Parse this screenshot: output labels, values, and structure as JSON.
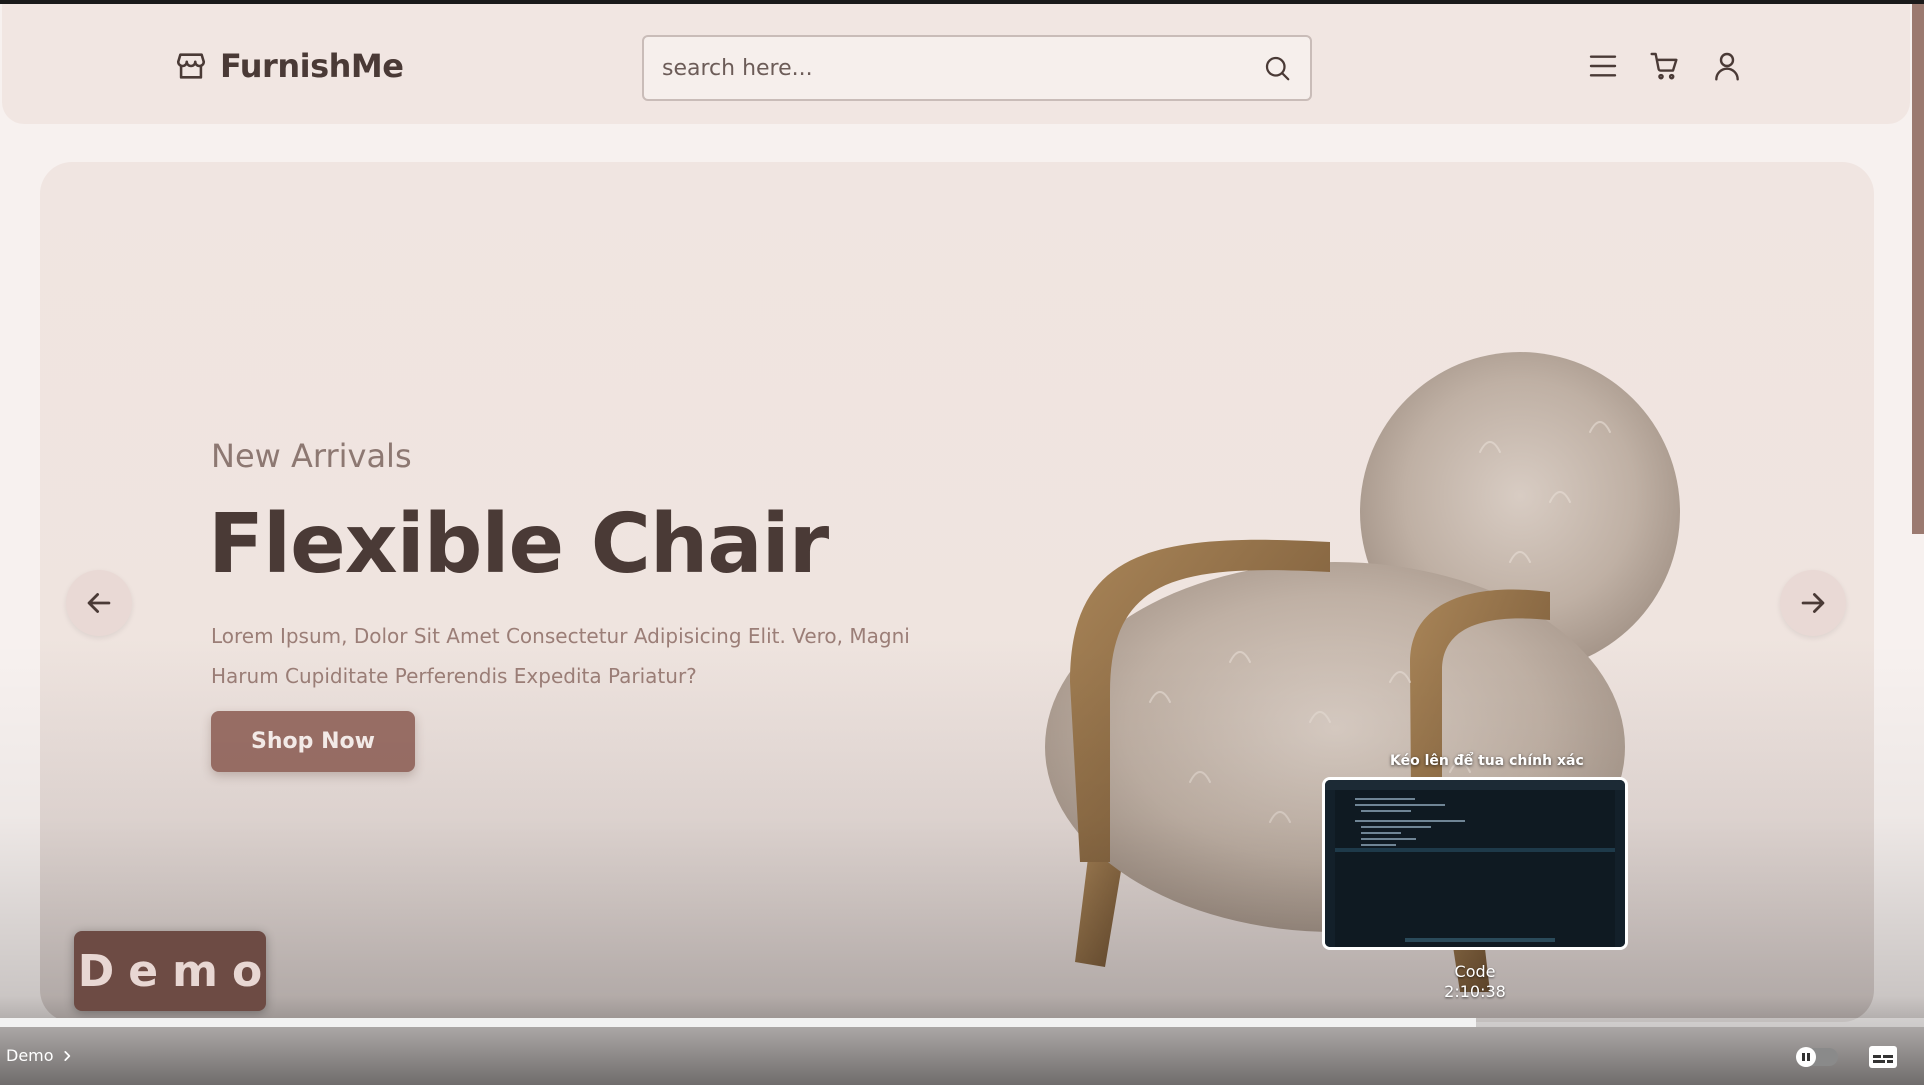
{
  "header": {
    "logo_text": "FurnishMe",
    "search_placeholder": "search here...",
    "icons": [
      "store-icon",
      "search-icon",
      "menu-icon",
      "cart-icon",
      "user-icon"
    ]
  },
  "hero": {
    "subtitle": "New Arrivals",
    "title": "Flexible Chair",
    "description": "Lorem Ipsum, Dolor Sit Amet Consectetur Adipisicing Elit. Vero, Magni Harum Cupiditate Perferendis Expedita Pariatur?",
    "cta_label": "Shop Now"
  },
  "overlay": {
    "demo_badge": "Demo",
    "preview_hint": "Kéo lên để tua chính xác",
    "preview_title": "Code",
    "preview_time": "2:10:38",
    "chapter_label": "Demo",
    "progress_fraction": 0.767
  },
  "colors": {
    "header_bg": "#f1e6e2",
    "hero_bg": "#f0e5e1",
    "text_dark": "#4a3a36",
    "cta": "#9a6f66",
    "badge": "#6d4b44"
  }
}
